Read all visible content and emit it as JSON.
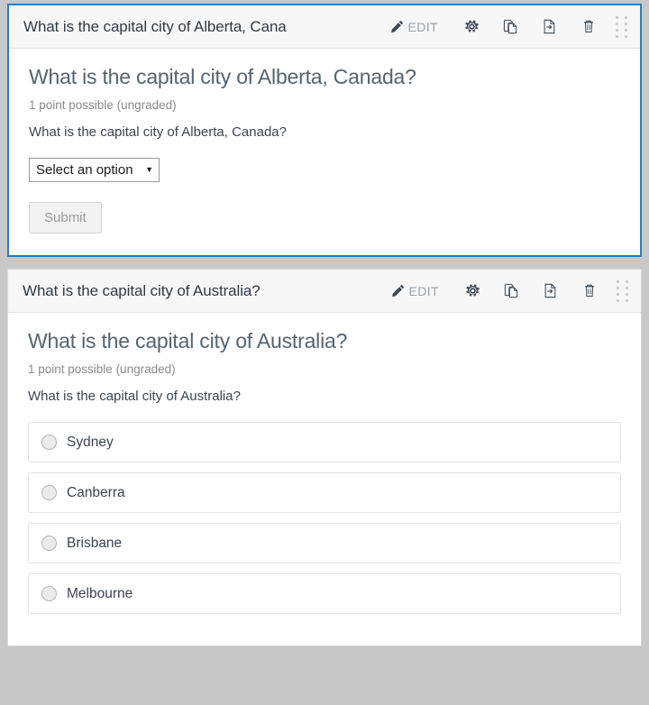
{
  "cards": [
    {
      "header_title": "What is the capital city of Alberta, Cana",
      "edit_label": "EDIT",
      "selected": true,
      "question_heading": "What is the capital city of Alberta, Canada?",
      "points_text": "1 point possible (ungraded)",
      "prompt_text": "What is the capital city of Alberta, Canada?",
      "input_type": "dropdown",
      "dropdown_value": "Select an option",
      "dropdown_caret": "▼",
      "submit_label": "Submit"
    },
    {
      "header_title": "What is the capital city of Australia?",
      "edit_label": "EDIT",
      "selected": false,
      "question_heading": "What is the capital city of Australia?",
      "points_text": "1 point possible (ungraded)",
      "prompt_text": "What is the capital city of Australia?",
      "input_type": "radio",
      "choices": [
        {
          "label": "Sydney",
          "checked": false
        },
        {
          "label": "Canberra",
          "checked": false
        },
        {
          "label": "Brisbane",
          "checked": false
        },
        {
          "label": "Melbourne",
          "checked": false
        }
      ]
    }
  ],
  "header_icons": [
    {
      "name": "pencil-icon",
      "title": "Edit"
    },
    {
      "name": "gear-icon",
      "title": "Settings"
    },
    {
      "name": "duplicate-icon",
      "title": "Duplicate"
    },
    {
      "name": "move-icon",
      "title": "Move"
    },
    {
      "name": "trash-icon",
      "title": "Delete"
    },
    {
      "name": "drag-handle-icon",
      "title": "Drag to reorder"
    }
  ],
  "colors": {
    "selected_border": "#2b7bbf",
    "page_background": "#c8c8c8",
    "card_header_background": "#f7f7f7",
    "heading_text": "#55646f",
    "muted_text": "#8a8a8a",
    "edit_label": "#9aa2a8",
    "icon": "#3f4a55"
  }
}
